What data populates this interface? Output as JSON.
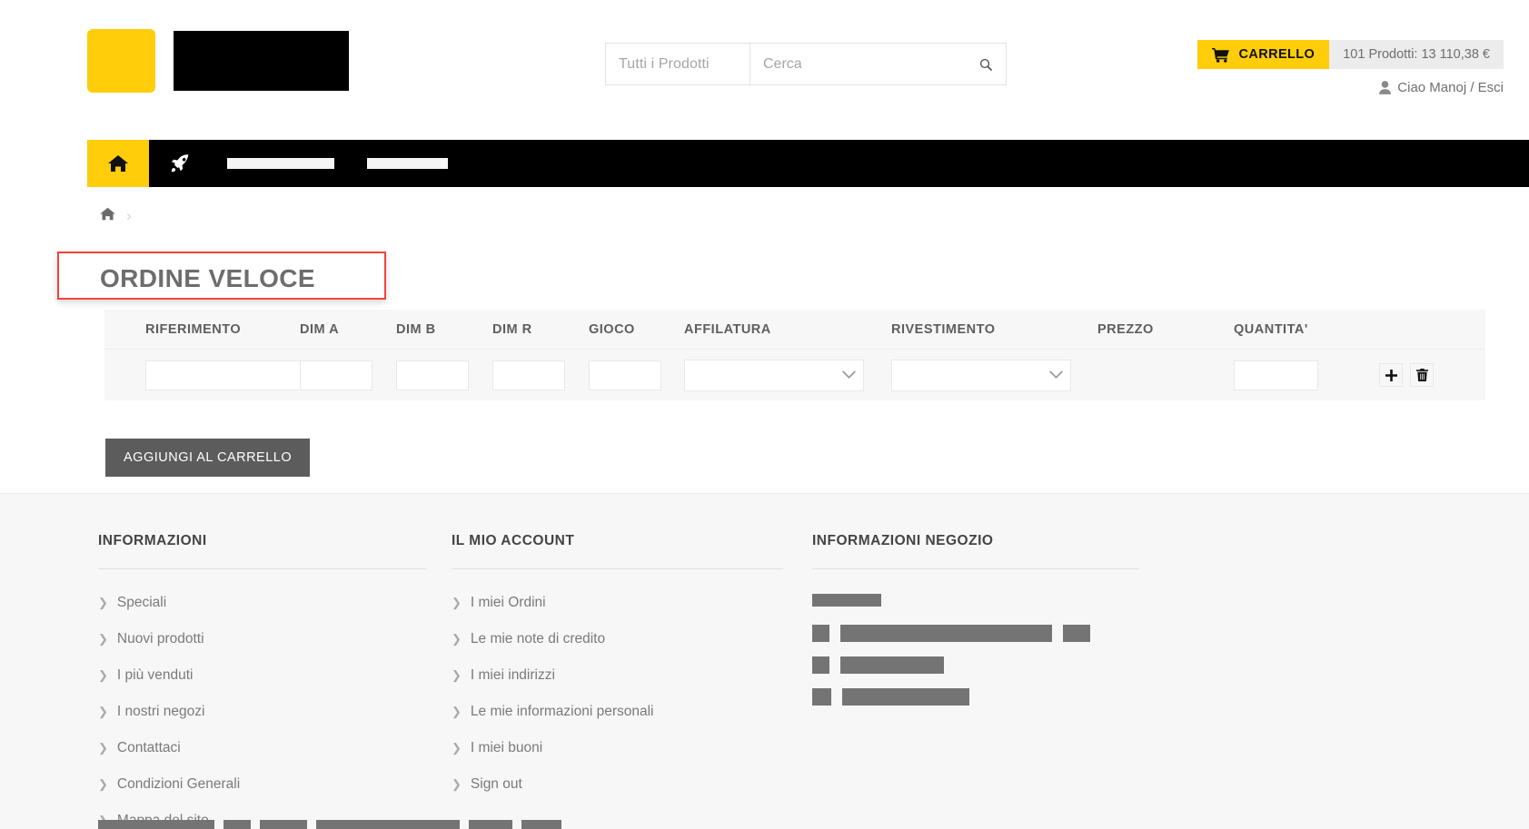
{
  "header": {
    "search": {
      "category_placeholder": "Tutti i Prodotti",
      "query_placeholder": "Cerca",
      "query_value": "",
      "search_icon": "search-icon"
    },
    "cart": {
      "label": "CARRELLO",
      "summary": "101 Prodotti: 13 110,38 €",
      "icon": "shopping-cart-icon",
      "accent_color": "#ffcd0a"
    },
    "user": {
      "greeting": "Ciao Manoj / Esci",
      "icon": "user-icon"
    },
    "logo": {
      "mark_color": "#ffcd0a",
      "word_color": "#000000"
    }
  },
  "nav": {
    "home_icon": "home-icon",
    "rocket_icon": "rocket-icon",
    "items": [
      {
        "label": "",
        "redacted": true
      },
      {
        "label": "",
        "redacted": true
      }
    ],
    "background_color": "#000000",
    "active_color": "#ffcd0a"
  },
  "breadcrumb": {
    "home_icon": "home-icon",
    "separator": "›"
  },
  "main": {
    "page_title": "ORDINE VELOCE",
    "highlight_color": "#f2433a",
    "table": {
      "columns": [
        "RIFERIMENTO",
        "DIM A",
        "DIM B",
        "DIM R",
        "GIOCO",
        "AFFILATURA",
        "RIVESTIMENTO",
        "PREZZO",
        "QUANTITA'"
      ],
      "rows": [
        {
          "riferimento": "",
          "dim_a": "",
          "dim_b": "",
          "dim_r": "",
          "gioco": "",
          "affilatura": "",
          "rivestimento": "",
          "prezzo": "",
          "quantita": "",
          "add_icon": "plus-icon",
          "delete_icon": "trash-icon"
        }
      ]
    },
    "add_to_cart_label": "AGGIUNGI AL CARRELLO"
  },
  "footer": {
    "columns": [
      {
        "title": "INFORMAZIONI",
        "links": [
          "Speciali",
          "Nuovi prodotti",
          "I più venduti",
          "I nostri negozi",
          "Contattaci",
          "Condizioni Generali",
          "Mappa del sito"
        ]
      },
      {
        "title": "IL MIO ACCOUNT",
        "links": [
          "I miei Ordini",
          "Le mie note di credito",
          "I miei indirizzi",
          "Le mie informazioni personali",
          "I miei buoni",
          "Sign out"
        ]
      },
      {
        "title": "INFORMAZIONI NEGOZIO",
        "links": [],
        "redacted_lines": [
          {
            "blocks": [
              76
            ]
          },
          {
            "blocks": [
              19,
              233,
              30
            ]
          },
          {
            "blocks": [
              19,
              114
            ]
          },
          {
            "blocks": [
              21,
              140
            ]
          }
        ]
      }
    ],
    "bottom_redacted_blocks": [
      128,
      30,
      52,
      158,
      48,
      44
    ]
  }
}
